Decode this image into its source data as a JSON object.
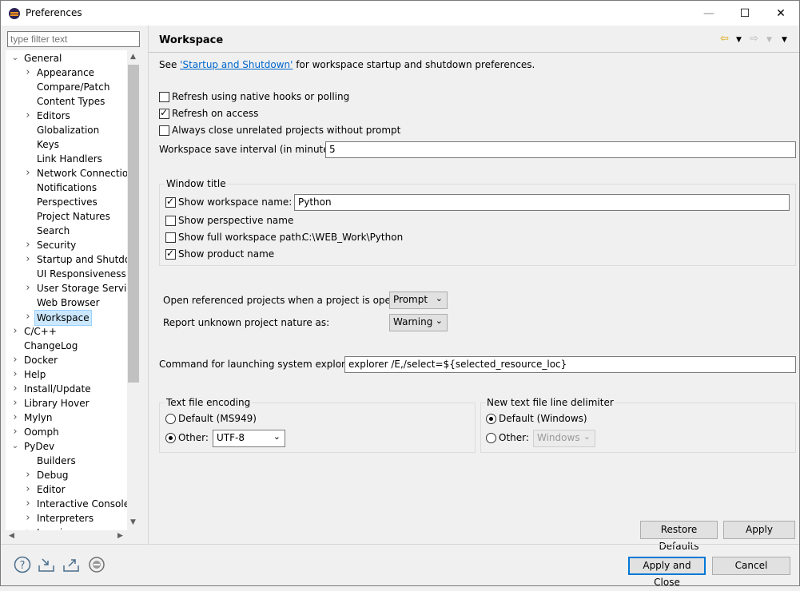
{
  "window": {
    "title": "Preferences",
    "minimize": "—",
    "maximize": "☐",
    "close": "✕"
  },
  "filter": {
    "placeholder": "type filter text"
  },
  "tree": [
    {
      "label": "General",
      "expanded": true,
      "level": 0
    },
    {
      "label": "Appearance",
      "expandable": true,
      "level": 1
    },
    {
      "label": "Compare/Patch",
      "level": 1
    },
    {
      "label": "Content Types",
      "level": 1
    },
    {
      "label": "Editors",
      "expandable": true,
      "level": 1
    },
    {
      "label": "Globalization",
      "level": 1
    },
    {
      "label": "Keys",
      "level": 1
    },
    {
      "label": "Link Handlers",
      "level": 1
    },
    {
      "label": "Network Connections",
      "expandable": true,
      "level": 1
    },
    {
      "label": "Notifications",
      "level": 1
    },
    {
      "label": "Perspectives",
      "level": 1
    },
    {
      "label": "Project Natures",
      "level": 1
    },
    {
      "label": "Search",
      "level": 1
    },
    {
      "label": "Security",
      "expandable": true,
      "level": 1
    },
    {
      "label": "Startup and Shutdown",
      "expandable": true,
      "level": 1
    },
    {
      "label": "UI Responsiveness Monitoring",
      "level": 1
    },
    {
      "label": "User Storage Service",
      "expandable": true,
      "level": 1
    },
    {
      "label": "Web Browser",
      "level": 1
    },
    {
      "label": "Workspace",
      "expandable": true,
      "level": 1,
      "selected": true
    },
    {
      "label": "C/C++",
      "expandable": true,
      "level": 0
    },
    {
      "label": "ChangeLog",
      "level": 0
    },
    {
      "label": "Docker",
      "expandable": true,
      "level": 0
    },
    {
      "label": "Help",
      "expandable": true,
      "level": 0
    },
    {
      "label": "Install/Update",
      "expandable": true,
      "level": 0
    },
    {
      "label": "Library Hover",
      "expandable": true,
      "level": 0
    },
    {
      "label": "Mylyn",
      "expandable": true,
      "level": 0
    },
    {
      "label": "Oomph",
      "expandable": true,
      "level": 0
    },
    {
      "label": "PyDev",
      "expanded": true,
      "level": 0
    },
    {
      "label": "Builders",
      "level": 1
    },
    {
      "label": "Debug",
      "expandable": true,
      "level": 1
    },
    {
      "label": "Editor",
      "expandable": true,
      "level": 1
    },
    {
      "label": "Interactive Console",
      "expandable": true,
      "level": 1
    },
    {
      "label": "Interpreters",
      "expandable": true,
      "level": 1
    },
    {
      "label": "Logging",
      "expandable": true,
      "level": 1
    }
  ],
  "page": {
    "title": "Workspace",
    "see_prefix": "See ",
    "see_link": "'Startup and Shutdown'",
    "see_suffix": " for workspace startup and shutdown preferences.",
    "refresh_native": "Refresh using native hooks or polling",
    "refresh_access": "Refresh on access",
    "always_close": "Always close unrelated projects without prompt",
    "save_interval_label": "Workspace save interval (in minutes):",
    "save_interval_value": "5",
    "window_title": {
      "group_label": "Window title",
      "show_ws_name": "Show workspace name:",
      "ws_name_value": "Python",
      "show_perspective": "Show perspective name",
      "show_full_path": "Show full workspace path:",
      "full_path_value": "C:\\WEB_Work\\Python",
      "show_product": "Show product name"
    },
    "open_ref_label": "Open referenced projects when a project is opened:",
    "open_ref_value": "Prompt",
    "report_label": "Report unknown project nature as:",
    "report_value": "Warning",
    "cmd_label": "Command for launching system explorer:",
    "cmd_value": "explorer /E,/select=${selected_resource_loc}",
    "encoding": {
      "group_label": "Text file encoding",
      "default_label": "Default (MS949)",
      "other_label": "Other:",
      "other_value": "UTF-8"
    },
    "delimiter": {
      "group_label": "New text file line delimiter",
      "default_label": "Default (Windows)",
      "other_label": "Other:",
      "other_value": "Windows"
    },
    "restore_defaults": "Restore Defaults",
    "apply": "Apply"
  },
  "footer": {
    "apply_close": "Apply and Close",
    "cancel": "Cancel"
  }
}
